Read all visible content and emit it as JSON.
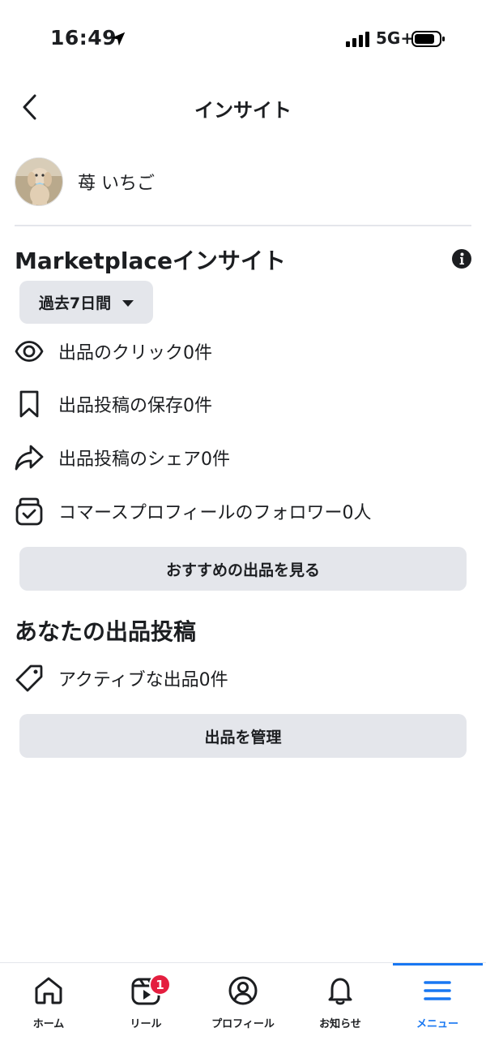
{
  "status_bar": {
    "time": "16:49",
    "network": "5G+"
  },
  "header": {
    "title": "インサイト"
  },
  "profile": {
    "name": "苺 いちご"
  },
  "marketplace": {
    "title": "Marketplaceインサイト",
    "range_label": "過去7日間",
    "stats": [
      {
        "icon": "eye-icon",
        "label": "出品のクリック0件"
      },
      {
        "icon": "bookmark-icon",
        "label": "出品投稿の保存0件"
      },
      {
        "icon": "share-icon",
        "label": "出品投稿のシェア0件"
      },
      {
        "icon": "shop-icon",
        "label": "コマースプロフィールのフォロワー0人"
      }
    ],
    "recommend_button": "おすすめの出品を見る"
  },
  "your_listings": {
    "title": "あなたの出品投稿",
    "active_label": "アクティブな出品0件",
    "manage_button": "出品を管理"
  },
  "tab_bar": {
    "tabs": [
      {
        "label": "ホーム",
        "icon": "home-icon"
      },
      {
        "label": "リール",
        "icon": "reels-icon",
        "badge": "1"
      },
      {
        "label": "プロフィール",
        "icon": "profile-icon"
      },
      {
        "label": "お知らせ",
        "icon": "bell-icon"
      },
      {
        "label": "メニュー",
        "icon": "menu-icon",
        "active": true
      }
    ]
  },
  "colors": {
    "accent": "#1877f2",
    "button_bg": "#e4e6eb",
    "badge": "#e41e3f",
    "text": "#1c1e21"
  }
}
